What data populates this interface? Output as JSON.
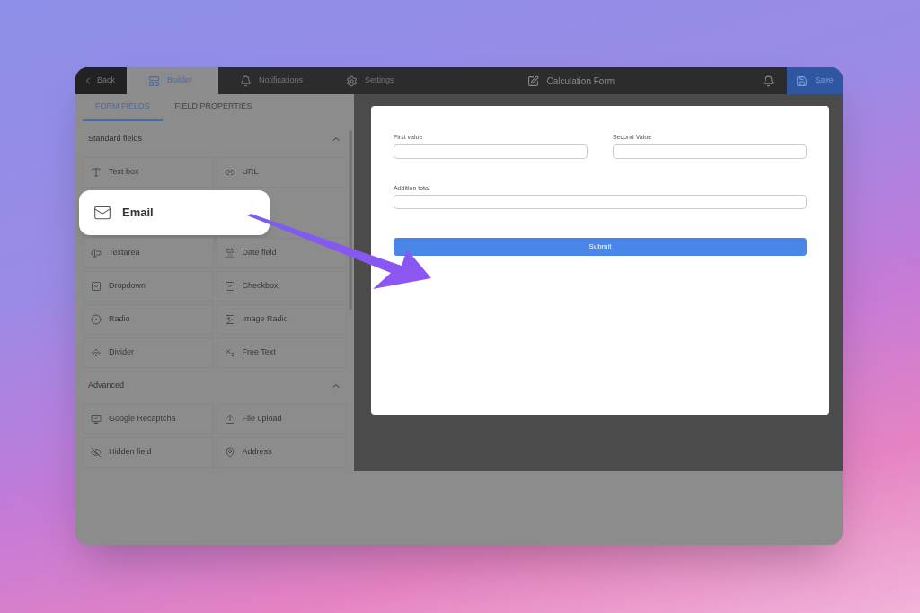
{
  "top_bar": {
    "back": "Back",
    "tabs": [
      {
        "label": "Builder",
        "kind": "builder",
        "selected": true
      },
      {
        "label": "Notifications",
        "kind": "bell",
        "selected": false
      },
      {
        "label": "Settings",
        "kind": "gear",
        "selected": false
      }
    ],
    "title": "Calculation Form",
    "save": "Save"
  },
  "panel_tabs": [
    {
      "label": "FORM FIELDS",
      "selected": true
    },
    {
      "label": "FIELD PROPERTIES",
      "selected": false
    }
  ],
  "sections": [
    {
      "title": "Standard fields",
      "expanded": true,
      "rows": [
        [
          {
            "label": "Text box",
            "kind": "text",
            "highlighted": false
          },
          {
            "label": "URL",
            "kind": "link",
            "highlighted": false
          }
        ],
        [
          {
            "label": "Email",
            "kind": "mail",
            "highlighted": true
          }
        ],
        [
          {
            "label": "Textarea",
            "kind": "textarea",
            "highlighted": false
          },
          {
            "label": "Date field",
            "kind": "calendar",
            "highlighted": false
          }
        ],
        [
          {
            "label": "Dropdown",
            "kind": "dropdown",
            "highlighted": false
          },
          {
            "label": "Checkbox",
            "kind": "checkbox",
            "highlighted": false
          }
        ],
        [
          {
            "label": "Radio",
            "kind": "radio",
            "highlighted": false
          },
          {
            "label": "Image Radio",
            "kind": "image",
            "highlighted": false
          }
        ],
        [
          {
            "label": "Divider",
            "kind": "divider",
            "highlighted": false
          },
          {
            "label": "Free Text",
            "kind": "freetext",
            "highlighted": false
          }
        ]
      ]
    },
    {
      "title": "Advanced",
      "expanded": true,
      "rows": [
        [
          {
            "label": "Google Recaptcha",
            "kind": "captcha",
            "highlighted": false
          },
          {
            "label": "File upload",
            "kind": "upload",
            "highlighted": false
          }
        ],
        [
          {
            "label": "Hidden field",
            "kind": "hidden",
            "highlighted": false
          },
          {
            "label": "Address",
            "kind": "pin",
            "highlighted": false
          }
        ]
      ]
    }
  ],
  "form": {
    "fields": [
      {
        "label": "First value",
        "kind": "half"
      },
      {
        "label": "Second Value",
        "kind": "half"
      },
      {
        "label": "Addition total",
        "kind": "full"
      }
    ],
    "submit": "Submit"
  }
}
